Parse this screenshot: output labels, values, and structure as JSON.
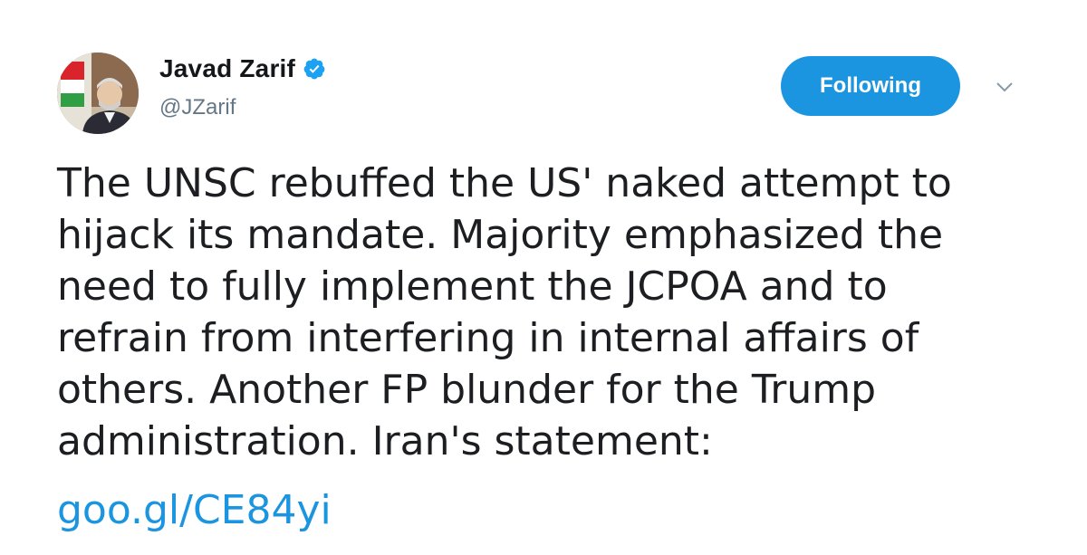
{
  "author": {
    "display_name": "Javad Zarif",
    "handle": "@JZarif",
    "verified": true
  },
  "follow_button": {
    "label": "Following"
  },
  "tweet": {
    "lines": [
      "The UNSC rebuffed the US' naked attempt to",
      "hijack its mandate. Majority emphasized the",
      "need to fully implement the JCPOA and to",
      "refrain from interfering in internal affairs of",
      "others. Another FP blunder for the Trump",
      "administration. Iran's statement:"
    ],
    "link": "goo.gl/CE84yi"
  },
  "colors": {
    "accent": "#1b95e0",
    "handle": "#657786",
    "text": "#1c1e21"
  },
  "icons": {
    "verified": "verified-badge-icon",
    "menu": "chevron-down-icon"
  }
}
